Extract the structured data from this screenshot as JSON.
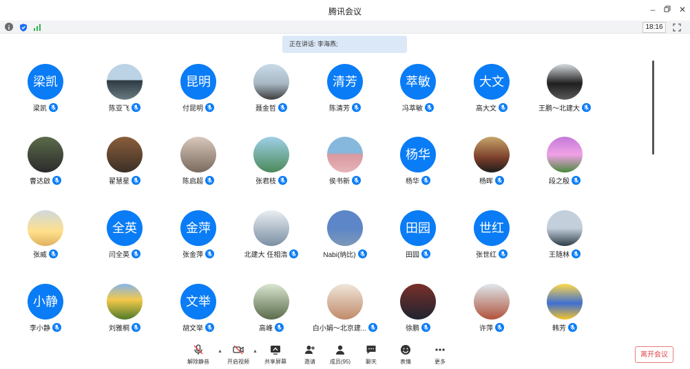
{
  "window": {
    "title": "腾讯会议"
  },
  "status": {
    "time": "18:16"
  },
  "speaking": "正在讲话: 李海燕;",
  "participants": [
    {
      "name": "梁凯",
      "avatar": "梁凯"
    },
    {
      "name": "陈亚飞",
      "avatar": ""
    },
    {
      "name": "付昆明",
      "avatar": "昆明"
    },
    {
      "name": "聂金哲",
      "avatar": ""
    },
    {
      "name": "陈清芳",
      "avatar": "清芳"
    },
    {
      "name": "冯萃敏",
      "avatar": "萃敏"
    },
    {
      "name": "高大文",
      "avatar": "大文"
    },
    {
      "name": "王鹏～北建大",
      "avatar": ""
    },
    {
      "name": "曹达啟",
      "avatar": ""
    },
    {
      "name": "翟慧星",
      "avatar": ""
    },
    {
      "name": "陈启超",
      "avatar": ""
    },
    {
      "name": "张君枝",
      "avatar": ""
    },
    {
      "name": "侯书新",
      "avatar": ""
    },
    {
      "name": "杨华",
      "avatar": "杨华"
    },
    {
      "name": "杨晖",
      "avatar": ""
    },
    {
      "name": "段之殷",
      "avatar": ""
    },
    {
      "name": "张威",
      "avatar": ""
    },
    {
      "name": "闫全英",
      "avatar": "全英"
    },
    {
      "name": "张金萍",
      "avatar": "金萍"
    },
    {
      "name": "北建大 任相浩",
      "avatar": ""
    },
    {
      "name": "Nabi(纳比)",
      "avatar": ""
    },
    {
      "name": "田园",
      "avatar": "田园"
    },
    {
      "name": "张世红",
      "avatar": "世红"
    },
    {
      "name": "王随林",
      "avatar": ""
    },
    {
      "name": "李小静",
      "avatar": "小静"
    },
    {
      "name": "刘雅桐",
      "avatar": ""
    },
    {
      "name": "胡文举",
      "avatar": "文举"
    },
    {
      "name": "高峰",
      "avatar": ""
    },
    {
      "name": "白小娟～北京建...",
      "avatar": ""
    },
    {
      "name": "徐鹏",
      "avatar": ""
    },
    {
      "name": "许萍",
      "avatar": ""
    },
    {
      "name": "韩芳",
      "avatar": ""
    }
  ],
  "toolbar": {
    "unmute": "解除静音",
    "video": "开启视频",
    "share": "共享屏幕",
    "invite": "邀请",
    "members": "成员(95)",
    "chat": "聊天",
    "reaction": "表情",
    "more": "更多",
    "leave": "离开会议"
  },
  "colors": {
    "accent": "#0a7cf6",
    "leave": "#e04545"
  }
}
